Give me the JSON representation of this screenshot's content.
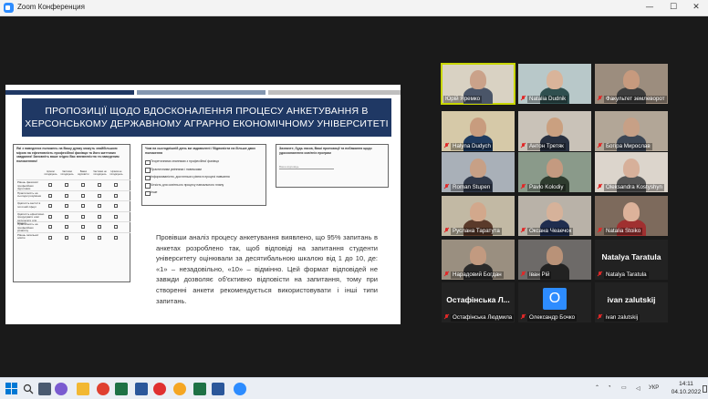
{
  "window": {
    "title": "Zoom Конференция",
    "controls": [
      "—",
      "☐",
      "✕"
    ]
  },
  "slide": {
    "title_line1": "ПРОПОЗИЦІЇ ЩОДО ВДОСКОНАЛЕННЯ ПРОЦЕСУ АНКЕТУВАННЯ В",
    "title_line2": "ХЕРСОНСЬКОМУ ДЕРЖАВНОМУ АГРАРНО ЕКОНОМІЧНОМУ УНІВЕРСИТЕТІ",
    "topbar_colors": [
      "#1f3864",
      "#8497b0",
      "#bfbfbf"
    ],
    "panel1_title": "Які з наведених положень на Вашу думку можуть знайбільшою мірою на ефективність професійної фахівця та його життєвих завдання! Заповніть ваше згідно Вас впевненістю та наведеним положенням!",
    "panel1_cols": [
      "Цілком погоджуюсь",
      "Частково погоджуюсь",
      "Важко відповісти",
      "Частково не погоджуюсь",
      "Цілком не погоджуюсь"
    ],
    "panel1_rows": [
      "Рівень фахових/професійних підготовки",
      "Практичність на сьогодні розуміння",
      "Здатність вести/ в поточній сфері",
      "Здатність ефективно продукувати нові результати для бізнесу",
      "Практичність на професійних розвитку",
      "Рівень загальної освіти"
    ],
    "panel2_title": "Чим на сьогоднішній день ви задоволені / Відповісти на більше двох положення",
    "panel2_options": [
      "Теоретичними знаннями з професійної фахівця",
      "Практичними уміннями і навичками",
      "Інформованістю, достатнього рівня в процесі навчання",
      "Чіткість для освітнього процесу навчального плану",
      "Інше"
    ],
    "panel3_title": "Зазначте, будь ласка, Ваші пропозиції та побажання щодо удосконалення освітніх програм",
    "panel3_placeholder": "Ваша відповідь",
    "body_text": "Провівши аналіз процесу анкетування виявлено, що 95% запитань в анкетах розроблено так, щоб відповіді на запитання студенти університету оцінювали за десятибальною шкалою від 1 до 10, де: «1» – незадовільно, «10» – відмінно. Цей формат відповідей не завжди дозволяє об'єктивно відповісти на запитання, тому при створенні анкети рекомендується використовувати і інші типи запитань."
  },
  "participants": [
    {
      "name": "Юрій Яремко",
      "muted": false,
      "active": true,
      "type": "video",
      "bg": "#d9d2c3",
      "skin": "#caa28a",
      "shirt": "#4a5568"
    },
    {
      "name": "Natalia Dudnik",
      "muted": true,
      "active": false,
      "type": "video",
      "bg": "#b8c8c9",
      "skin": "#d9b49a",
      "shirt": "#2f4f4f"
    },
    {
      "name": "Факультет землеворот",
      "muted": true,
      "active": false,
      "type": "video",
      "bg": "#9c8d7e",
      "skin": "#c79a7e",
      "shirt": "#3d3d3d"
    },
    {
      "name": "Halyna Dudych",
      "muted": true,
      "active": false,
      "type": "video",
      "bg": "#d6c9a8",
      "skin": "#c89c7e",
      "shirt": "#1e3a5f"
    },
    {
      "name": "Антон Третяк",
      "muted": true,
      "active": false,
      "type": "video",
      "bg": "#c9c2b8",
      "skin": "#caa080",
      "shirt": "#283040"
    },
    {
      "name": "Богіра Мирослав",
      "muted": true,
      "active": false,
      "type": "video",
      "bg": "#b2a697",
      "skin": "#c7a086",
      "shirt": "#3c4654"
    },
    {
      "name": "Roman Stupen",
      "muted": true,
      "active": false,
      "type": "video",
      "bg": "#a9b0b8",
      "skin": "#c7a086",
      "shirt": "#30394a"
    },
    {
      "name": "Pavlo Kolodiy",
      "muted": true,
      "active": false,
      "type": "video",
      "bg": "#8a9a8a",
      "skin": "#c49a80",
      "shirt": "#2e3b2e"
    },
    {
      "name": "Oleksandra Kostyshyn",
      "muted": true,
      "active": false,
      "type": "video",
      "bg": "#dcd5cc",
      "skin": "#d7b09a",
      "shirt": "#555555"
    },
    {
      "name": "Руслана Таратута",
      "muted": true,
      "active": false,
      "type": "video",
      "bg": "#c2b9a4",
      "skin": "#d2a88c",
      "shirt": "#5a3a2a"
    },
    {
      "name": "Оксана Чеаечок",
      "muted": true,
      "active": false,
      "type": "video",
      "bg": "#b9b2a8",
      "skin": "#d6b29a",
      "shirt": "#1f2d4f"
    },
    {
      "name": "Natalia Stoiko",
      "muted": true,
      "active": false,
      "type": "video",
      "bg": "#7d6a5c",
      "skin": "#dcb29a",
      "shirt": "#a03030"
    },
    {
      "name": "Нарадовий Богдан",
      "muted": true,
      "active": false,
      "type": "video",
      "bg": "#9a8f80",
      "skin": "#c29a80",
      "shirt": "#2a2a2a"
    },
    {
      "name": "Іван Рій",
      "muted": true,
      "active": false,
      "type": "video",
      "bg": "#6d6a68",
      "skin": "#b99278",
      "shirt": "#222222"
    },
    {
      "name": "Natalya Taratula",
      "muted": true,
      "active": false,
      "type": "name",
      "big": "Natalya Taratula"
    },
    {
      "name": "Остафінська Людмила",
      "muted": true,
      "active": false,
      "type": "name",
      "big": "Остафінська Л..."
    },
    {
      "name": "Олександр Бочко",
      "muted": true,
      "active": false,
      "type": "initial",
      "initial": "О"
    },
    {
      "name": "ivan zalutskij",
      "muted": true,
      "active": false,
      "type": "name",
      "big": "ivan zalutskij"
    }
  ],
  "taskbar": {
    "apps": [
      {
        "icon": "task-view-icon",
        "color": "#4a5a70"
      },
      {
        "icon": "cortana-icon",
        "color": "#7a5bd0"
      },
      {
        "icon": "file-explorer-icon",
        "color": "#f2b833"
      },
      {
        "icon": "chrome-icon",
        "color": "#e04030"
      },
      {
        "icon": "excel-icon",
        "color": "#1e7145"
      },
      {
        "icon": "word-icon",
        "color": "#2b579a"
      },
      {
        "icon": "yandex-icon",
        "color": "#e03030"
      },
      {
        "icon": "yandex-browser-icon",
        "color": "#f5a623"
      },
      {
        "icon": "excel-icon",
        "color": "#1e7145"
      },
      {
        "icon": "word-icon",
        "color": "#2b579a"
      },
      {
        "icon": "zoom-icon",
        "color": "#2d8cff"
      }
    ],
    "language": "УКР",
    "time": "14:11",
    "date": "04.10.2022"
  }
}
